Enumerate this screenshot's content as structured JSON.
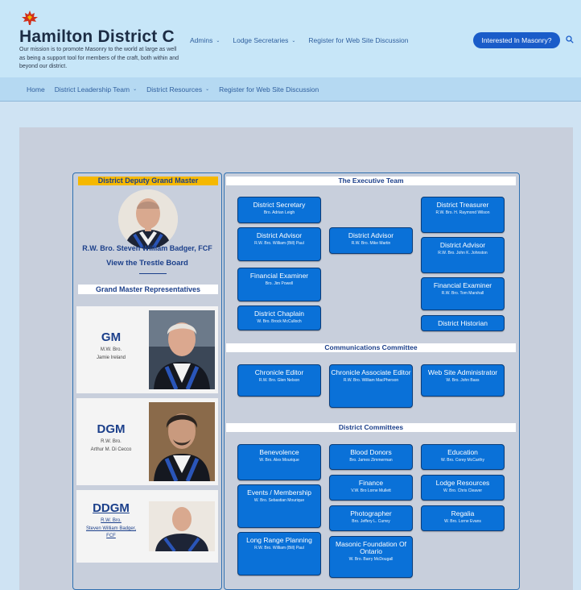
{
  "header": {
    "site_title": "Hamilton District C",
    "tagline": "Our mission is to promote Masonry to the world at large as well as being a support tool for members of the craft, both within and beyond our district.",
    "nav": [
      "Admins",
      "Lodge Secretaries",
      "Register for Web Site Discussion"
    ],
    "cta": "Interested In Masonry?",
    "brand_color": "#1a5cc9"
  },
  "subnav": [
    "Home",
    "District Leadership Team",
    "District Resources",
    "Register for Web Site Discussion"
  ],
  "left": {
    "ddgm_header": "District Deputy Grand Master",
    "ddgm_name": "R.W. Bro. Steven William Badger, FCF",
    "trestle": "View the Trestle Board",
    "gmr_header": "Grand Master Representatives",
    "reps": [
      {
        "title": "GM",
        "rank": "M.W. Bro.",
        "name": "Jamie Ireland"
      },
      {
        "title": "DGM",
        "rank": "R.W. Bro.",
        "name": "Arthur M. Di Cecco"
      },
      {
        "title": "DDGM",
        "rank": "R.W. Bro.",
        "name": "Steven William Badger, FCF"
      }
    ]
  },
  "exec": {
    "header": "The Executive Team",
    "secretary": {
      "title": "District Secretary",
      "name": "Bro. Adrian Leigh"
    },
    "advisor1": {
      "title": "District Advisor",
      "name": "R.W. Bro. William (Bill) Paul"
    },
    "advisor_mid": {
      "title": "District Advisor",
      "name": "R.W. Bro. Mike Martin"
    },
    "fin_exam1": {
      "title": "Financial Examiner",
      "name": "Bro. Jim Powell"
    },
    "chaplain": {
      "title": "District Chaplain",
      "name": "W. Bro. Brock McCulloch"
    },
    "treasurer": {
      "title": "District Treasurer",
      "name": "R.W. Bro. H. Raymond Wilson"
    },
    "advisor2": {
      "title": "District Advisor",
      "name": "R.W. Bro. John K. Johnston"
    },
    "fin_exam2": {
      "title": "Financial Examiner",
      "name": "R.W. Bro. Tom Marshall"
    },
    "historian": {
      "title": "District Historian"
    }
  },
  "comms": {
    "header": "Communications Committee",
    "editor": {
      "title": "Chronicle Editor",
      "name": "R.W. Bro. Glen Nelson"
    },
    "assoc": {
      "title": "Chronicle Associate Editor",
      "name": "R.W. Bro. William MacPherson"
    },
    "webadmin": {
      "title": "Web Site Administrator",
      "name": "W. Bro. John Bass"
    }
  },
  "committees": {
    "header": "District Committees",
    "benevolence": {
      "title": "Benevolence",
      "name": "W. Bro. Alex Mourique"
    },
    "blood": {
      "title": "Blood Donors",
      "name": "Bro. James Zimmerman"
    },
    "education": {
      "title": "Education",
      "name": "W. Bro. Corey McCarthy"
    },
    "events": {
      "title": "Events / Membership",
      "name": "W. Bro. Sebastian Mourique"
    },
    "finance": {
      "title": "Finance",
      "name": "V.W. Bro Lorne Mullett"
    },
    "lodge_res": {
      "title": "Lodge Resources",
      "name": "W. Bro. Chris Cleaver"
    },
    "photographer": {
      "title": "Photographer",
      "name": "Bro. Jeffery L. Currey"
    },
    "regalia": {
      "title": "Regalia",
      "name": "W. Bro. Lorne Evans"
    },
    "longrange": {
      "title": "Long Range Planning",
      "name": "R.W. Bro. William (Bill) Paul"
    },
    "foundation": {
      "title": "Masonic Foundation Of Ontario",
      "name": "W. Bro. Barry McDougall"
    }
  }
}
